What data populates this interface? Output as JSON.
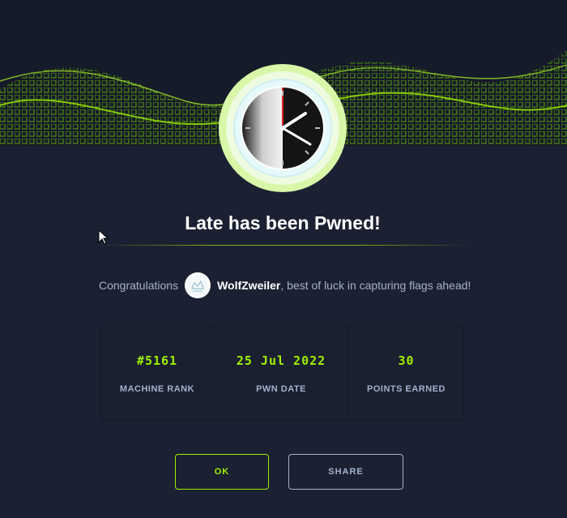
{
  "machine": {
    "title": "Late has been Pwned!"
  },
  "congrats": {
    "prefix": "Congratulations",
    "username": "WolfZweiler",
    "suffix": ", best of luck in capturing flags ahead!"
  },
  "stats": [
    {
      "value": "#5161",
      "label": "MACHINE RANK"
    },
    {
      "value": "25 Jul 2022",
      "label": "PWN DATE"
    },
    {
      "value": "30",
      "label": "POINTS EARNED"
    }
  ],
  "buttons": {
    "ok": "OK",
    "share": "SHARE"
  },
  "colors": {
    "accent": "#9fef00",
    "muted": "#a4b1cd",
    "background": "#1a2030"
  },
  "icons": [
    "machine-avatar-clock-icon",
    "user-avatar-icon",
    "mouse-cursor-icon"
  ]
}
